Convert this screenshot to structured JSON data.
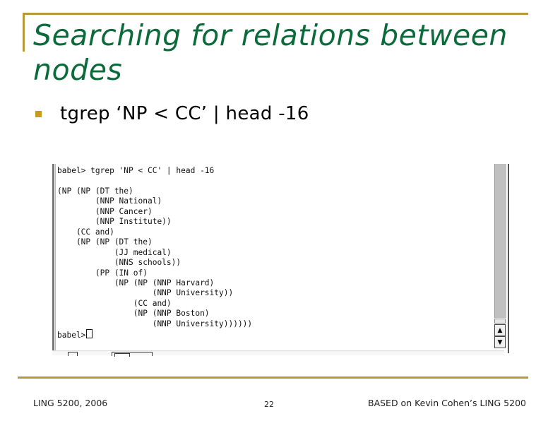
{
  "slide": {
    "title": "Searching for relations between nodes",
    "bullets": [
      {
        "text": "tgrep ‘NP < CC’ | head -16"
      }
    ]
  },
  "terminal": {
    "lines": [
      "babel> tgrep 'NP < CC' | head -16",
      "",
      "(NP (NP (DT the)",
      "        (NNP National)",
      "        (NNP Cancer)",
      "        (NNP Institute))",
      "    (CC and)",
      "    (NP (NP (DT the)",
      "            (JJ medical)",
      "            (NNS schools))",
      "        (PP (IN of)",
      "            (NP (NP (NNP Harvard)",
      "                    (NNP University))",
      "                (CC and)",
      "                (NP (NNP Boston)",
      "                    (NNP University))))))"
    ],
    "prompt": "babel>",
    "scrollbar": {
      "up_icon": "▲",
      "down_icon": "▼",
      "position_fraction": 1.0
    }
  },
  "footer": {
    "left": "LING 5200, 2006",
    "page_number": "22",
    "right": "BASED on Kevin Cohen’s LING 5200"
  },
  "colors": {
    "title": "#0b6b3a",
    "accent": "#b8993a",
    "bullet": "#c89a1e"
  }
}
